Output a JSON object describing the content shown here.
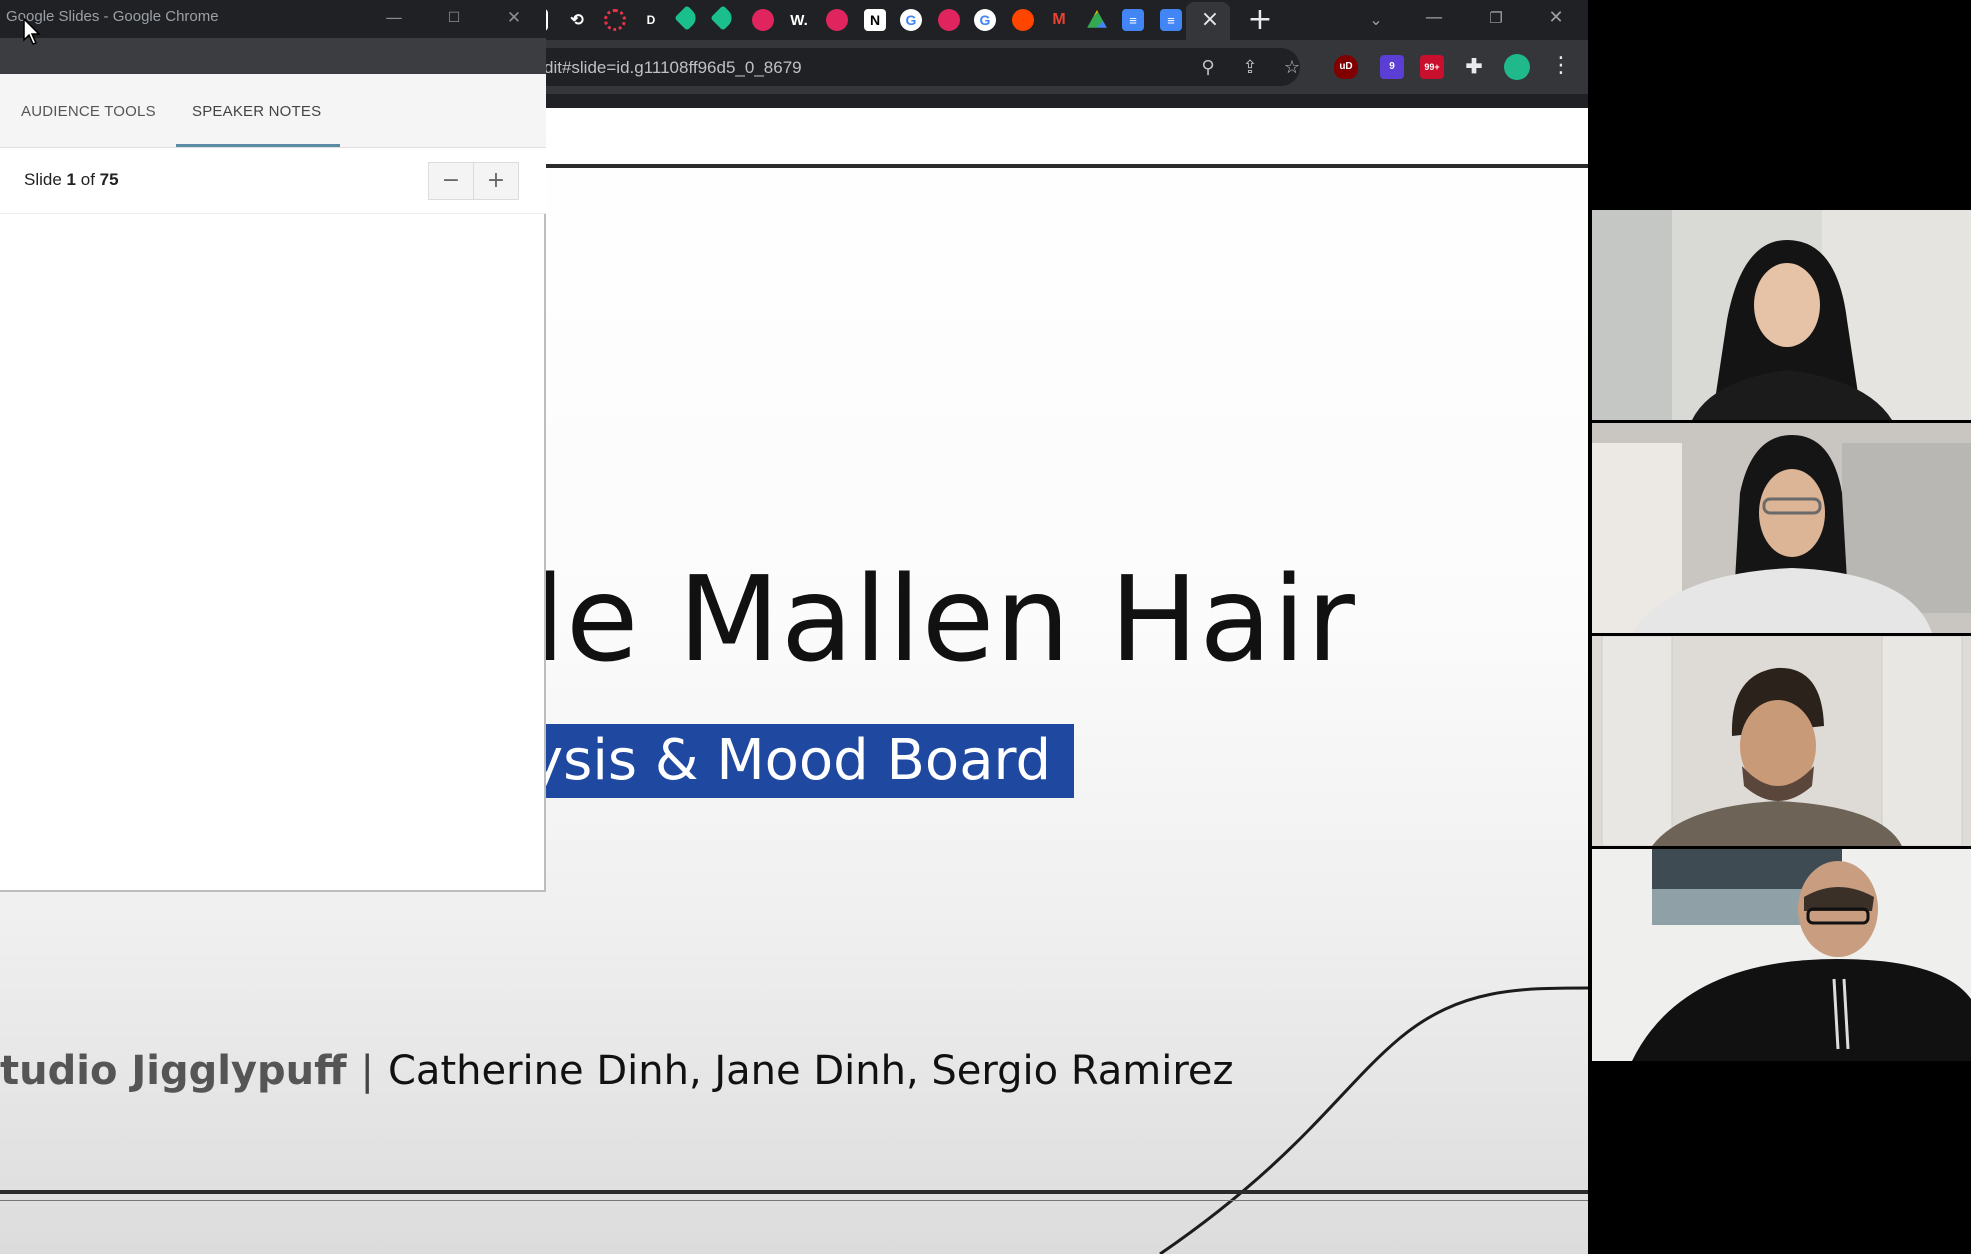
{
  "browser": {
    "url_fragment": "dit#slide=id.g11108ff96d5_0_8679",
    "tab_icons": [
      "dark-notes",
      "sync-icon",
      "red-loader-icon",
      "d-icon",
      "tag-icon",
      "tag-icon",
      "record-icon",
      "w-icon",
      "record-icon",
      "n-icon",
      "google-icon",
      "record-icon",
      "google-icon",
      "reddit-icon",
      "gmail-icon",
      "drive-icon",
      "docs-icon",
      "docs-icon"
    ],
    "tab_icon_labels": {
      "d": "D",
      "w": "W."
    },
    "extensions": {
      "ublock": "uD",
      "ext_badge": "9",
      "ext3": "99+"
    }
  },
  "presenter_window": {
    "title": "Google Slides - Google Chrome",
    "tabs": [
      {
        "label": "AUDIENCE TOOLS",
        "active": false
      },
      {
        "label": "SPEAKER NOTES",
        "active": true
      }
    ],
    "slide_counter": {
      "prefix": "Slide",
      "current": "1",
      "of": "of",
      "total": "75"
    },
    "zoom_out": "−",
    "zoom_in": "+"
  },
  "slide": {
    "title": "de Mallen Hair",
    "subtitle": "ysis & Mood Board",
    "credits_studio": "tudio Jigglypuff",
    "credits_sep": "|",
    "credits_names": "Catherine Dinh, Jane Dinh, Sergio Ramirez"
  },
  "participants": [
    {
      "id": "participant-1"
    },
    {
      "id": "participant-2"
    },
    {
      "id": "participant-3"
    },
    {
      "id": "participant-4"
    }
  ],
  "colors": {
    "chrome_dark": "#202124",
    "chrome_toolbar": "#35363a",
    "subtitle_bg": "#1f48a0",
    "tab_underline": "#5b8ba6"
  }
}
